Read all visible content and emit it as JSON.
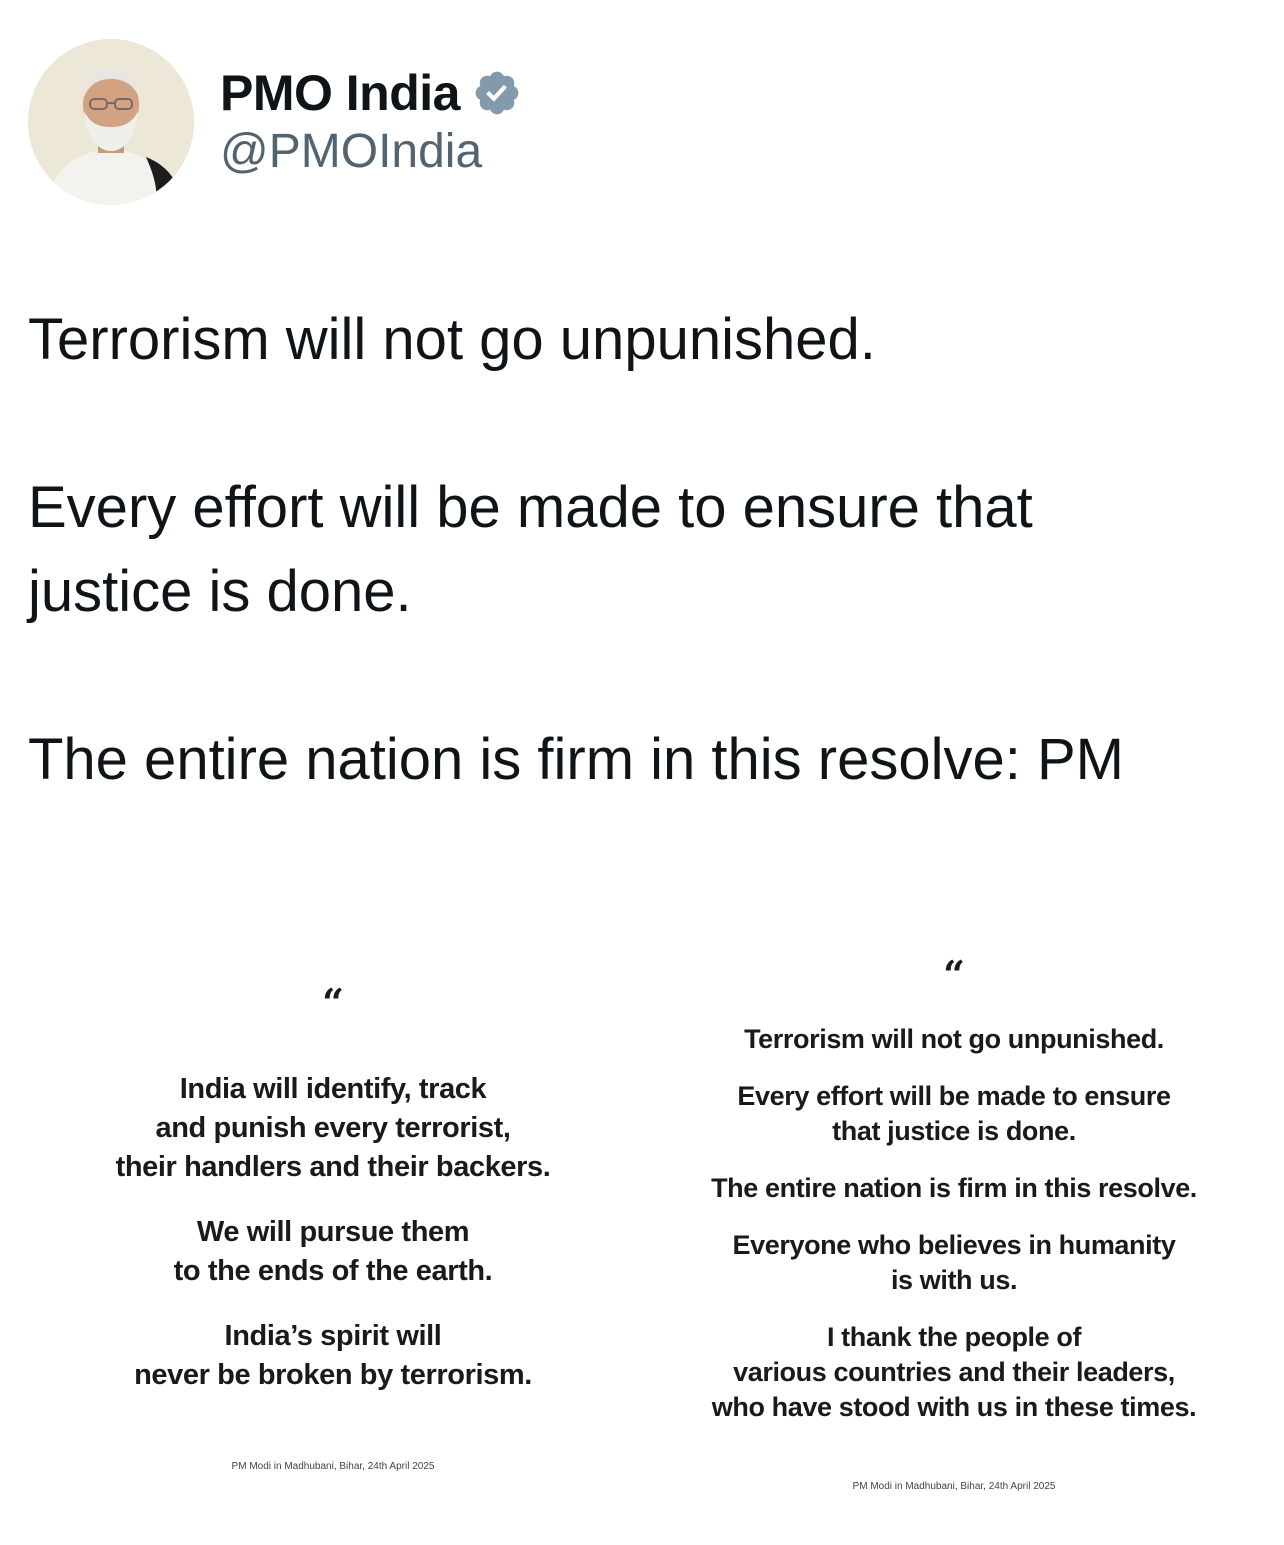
{
  "account": {
    "display_name": "PMO India",
    "handle": "@PMOIndia",
    "verified": true,
    "verified_color": "#829aab",
    "avatar_icon": "profile-photo"
  },
  "tweet": {
    "line1": "Terrorism will not go unpunished.",
    "line2a": "Every effort will be made to ensure that",
    "line2b": "justice is done.",
    "line3": "The entire nation is firm in this resolve: PM"
  },
  "images": {
    "left": {
      "quote_mark": "“",
      "p1": [
        "India will identify, track",
        "and punish every terrorist,",
        "their handlers and their backers."
      ],
      "p2": [
        "We will pursue them",
        "to the ends of the earth."
      ],
      "p3": [
        "India’s spirit will",
        "never be broken by terrorism."
      ],
      "credit": "PM Modi in Madhubani, Bihar, 24th April 2025"
    },
    "right": {
      "quote_mark": "“",
      "p1": [
        "Terrorism will not go unpunished."
      ],
      "p2": [
        "Every effort will be made to ensure",
        "that justice is done."
      ],
      "p3": [
        "The entire nation is firm in this resolve."
      ],
      "p4": [
        "Everyone who believes in humanity",
        "is with us."
      ],
      "p5": [
        "I thank the people of",
        "various countries and their leaders,",
        "who have stood with us in these times."
      ],
      "credit": "PM Modi in Madhubani, Bihar, 24th April 2025"
    }
  }
}
